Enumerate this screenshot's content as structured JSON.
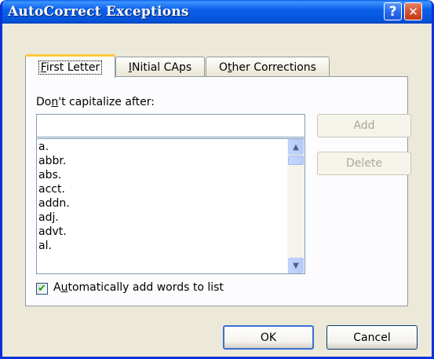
{
  "window": {
    "title": "AutoCorrect Exceptions",
    "help_glyph": "?",
    "close_glyph": "✕"
  },
  "tabs": [
    {
      "hot": "F",
      "rest": "irst Letter",
      "active": true
    },
    {
      "hot": "I",
      "rest": "Nitial CAps",
      "active": false
    },
    {
      "pre": "O",
      "hot": "t",
      "rest": "her Corrections",
      "active": false
    }
  ],
  "first_letter": {
    "label_pre": "Do",
    "label_hot": "n",
    "label_post": "'t capitalize after:",
    "input_value": "",
    "add_label": "Add",
    "delete_label": "Delete",
    "items": [
      "a.",
      "abbr.",
      "abs.",
      "acct.",
      "addn.",
      "adj.",
      "advt.",
      "al."
    ],
    "checkbox": {
      "checked": true,
      "pre": "A",
      "hot": "u",
      "post": "tomatically add words to list"
    }
  },
  "footer": {
    "ok_label": "OK",
    "cancel_label": "Cancel"
  },
  "colors": {
    "titlebar": "#0453d8",
    "dialog_bg": "#ece9d8",
    "active_tab_accent": "#ffc73c",
    "check": "#21a121"
  },
  "icons": {
    "help": "question-mark-icon",
    "close": "close-icon",
    "scroll_up": "chevron-up-icon",
    "scroll_down": "chevron-down-icon",
    "check": "checkmark-icon"
  }
}
